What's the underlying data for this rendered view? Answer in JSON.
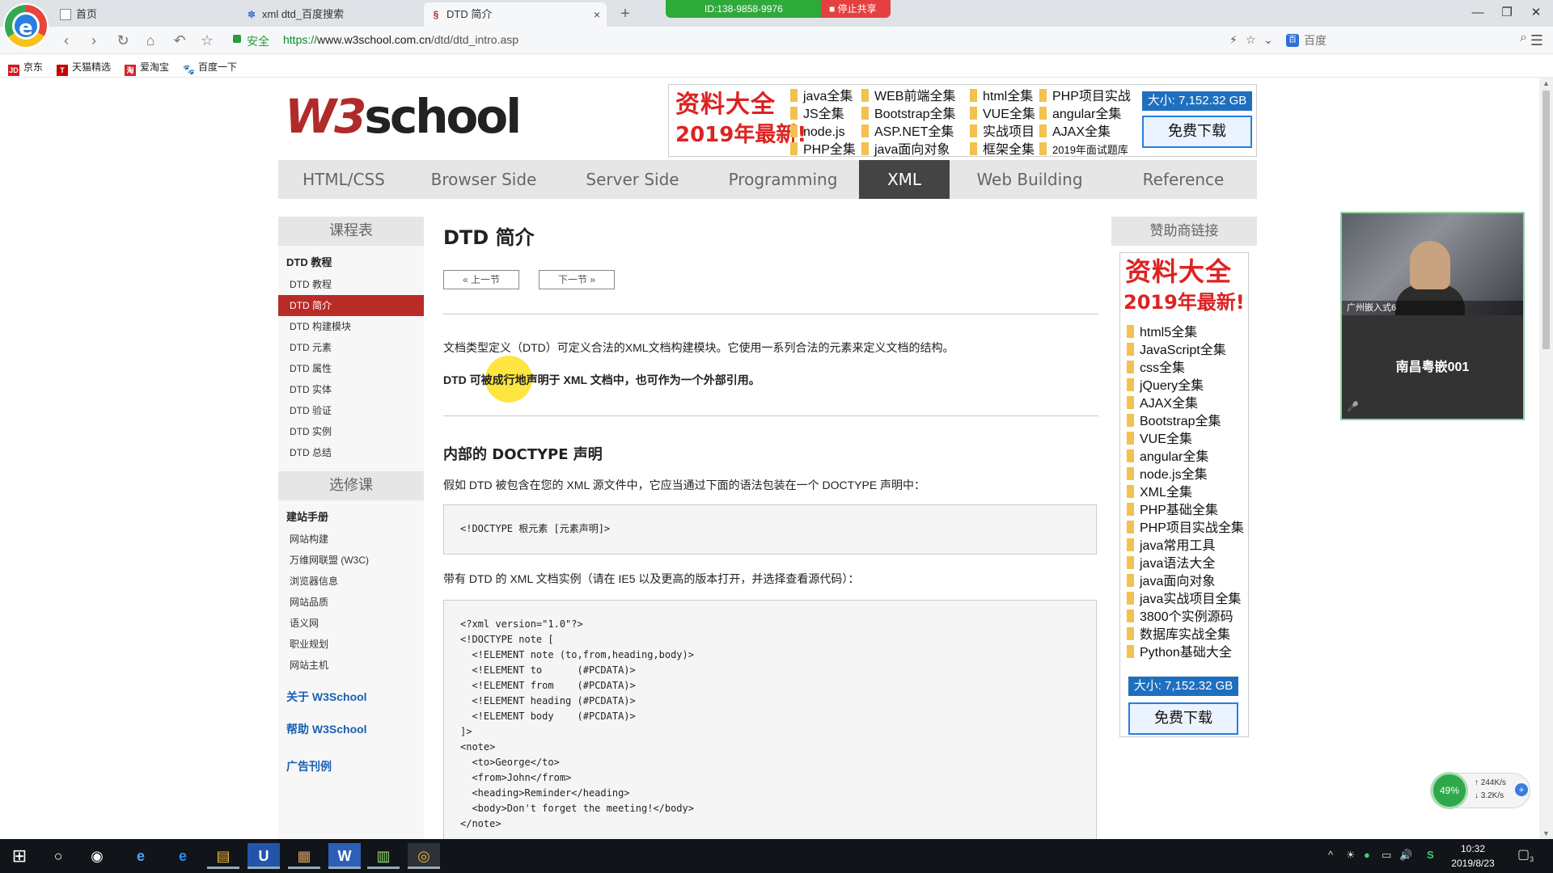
{
  "browser": {
    "tabs": [
      {
        "label": "首页",
        "icon": "document-icon"
      },
      {
        "label": "xml dtd_百度搜索",
        "icon": "baidu-paw-icon"
      },
      {
        "label": "DTD 简介",
        "icon": "w3school-favicon-icon"
      }
    ],
    "new_tab": "+",
    "close_tab": "×",
    "share": {
      "id_label": "ID:138-9858-9976",
      "stop_label": "停止共享"
    },
    "window_controls": {
      "minimize": "—",
      "restore": "❐",
      "close": "✕"
    },
    "nav": {
      "back": "‹",
      "forward": "›",
      "reload": "↻",
      "home": "⌂",
      "undo": "↶",
      "star": "☆"
    },
    "secure_label": "安全",
    "url_scheme": "https://",
    "url_domain": "www.w3school.com.cn",
    "url_path": "/dtd/dtd_intro.asp",
    "search_placeholder": "百度",
    "search_engine_glyph": "百",
    "search_go": "⌕",
    "menu": "☰",
    "right_tools": {
      "flash": "⚡",
      "star": "☆",
      "chevron": "⌄"
    },
    "bookmarks": [
      {
        "label": "京东",
        "badge": "JD",
        "color": "#d71920"
      },
      {
        "label": "天猫精选",
        "badge": "T",
        "color": "#c40000"
      },
      {
        "label": "爱淘宝",
        "badge": "淘",
        "color": "#d4232a"
      },
      {
        "label": "百度一下",
        "badge": "🐾",
        "color": "#2f6fd6"
      }
    ]
  },
  "site": {
    "logo_w3": "W3",
    "logo_school": "school",
    "ad_top": {
      "title": "资料大全",
      "subtitle": "2019年最新!",
      "columns": [
        [
          "java全集",
          "JS全集",
          "node.js",
          "PHP全集"
        ],
        [
          "WEB前端全集",
          "Bootstrap全集",
          "ASP.NET全集",
          "java面向对象"
        ],
        [
          "html全集",
          "VUE全集",
          "实战项目",
          "框架全集"
        ],
        [
          "PHP项目实战",
          "angular全集",
          "AJAX全集",
          "2019年面试题库"
        ]
      ],
      "size": "大小: 7,152.32 GB",
      "download": "免费下载"
    },
    "nav": [
      {
        "label": "HTML/CSS",
        "active": false
      },
      {
        "label": "Browser Side",
        "active": false
      },
      {
        "label": "Server Side",
        "active": false
      },
      {
        "label": "Programming",
        "active": false
      },
      {
        "label": "XML",
        "active": true
      },
      {
        "label": "Web Building",
        "active": false
      },
      {
        "label": "Reference",
        "active": false
      }
    ],
    "sidebar": {
      "course_title": "课程表",
      "group_title": "DTD 教程",
      "items": [
        "DTD 教程",
        "DTD 简介",
        "DTD 构建模块",
        "DTD 元素",
        "DTD 属性",
        "DTD 实体",
        "DTD 验证",
        "DTD 实例",
        "DTD 总结"
      ],
      "active_index": 1,
      "elective_title": "选修课",
      "site_group_title": "建站手册",
      "site_items": [
        "网站构建",
        "万维网联盟 (W3C)",
        "浏览器信息",
        "网站品质",
        "语义网",
        "职业规划",
        "网站主机"
      ],
      "links": [
        "关于 W3School",
        "帮助 W3School",
        "广告刊例"
      ]
    },
    "main": {
      "title": "DTD 简介",
      "prev": "« 上一节",
      "next": "下一节 »",
      "intro_p1": "文档类型定义（DTD）可定义合法的XML文档构建模块。它使用一系列合法的元素来定义文档的结构。",
      "intro_p2": "DTD 可被成行地声明于 XML 文档中，也可作为一个外部引用。",
      "section_title": "内部的 DOCTYPE 声明",
      "section_p": "假如 DTD 被包含在您的 XML 源文件中，它应当通过下面的语法包装在一个 DOCTYPE 声明中：",
      "syntax_code": "<!DOCTYPE 根元素 [元素声明]>",
      "example_p": "带有 DTD 的 XML 文档实例（请在 IE5 以及更高的版本打开，并选择查看源代码）：",
      "example_code": [
        "<?xml version=\"1.0\"?>",
        "<!DOCTYPE note [",
        "  <!ELEMENT note (to,from,heading,body)>",
        "  <!ELEMENT to      (#PCDATA)>",
        "  <!ELEMENT from    (#PCDATA)>",
        "  <!ELEMENT heading (#PCDATA)>",
        "  <!ELEMENT body    (#PCDATA)>",
        "]>",
        "<note>",
        "  <to>George</to>",
        "  <from>John</from>",
        "  <heading>Reminder</heading>",
        "  <body>Don't forget the meeting!</body>",
        "</note>"
      ]
    },
    "sponsor": {
      "head": "赞助商链接",
      "title": "资料大全",
      "subtitle": "2019年最新!",
      "items": [
        "html5全集",
        "JavaScript全集",
        "css全集",
        "jQuery全集",
        "AJAX全集",
        "Bootstrap全集",
        "VUE全集",
        "angular全集",
        "node.js全集",
        "XML全集",
        "PHP基础全集",
        "PHP项目实战全集",
        "java常用工具",
        "java语法大全",
        "java面向对象",
        "java实战项目全集",
        "3800个实例源码",
        "数据库实战全集",
        "Python基础大全"
      ],
      "size": "大小: 7,152.32 GB",
      "download": "免费下载"
    }
  },
  "scrollbar": {
    "up": "▲",
    "down": "▼"
  },
  "video": {
    "tag": "广州嵌入式6",
    "name": "南昌粤嵌001",
    "mic": "🎤"
  },
  "speed": {
    "percent": "49%",
    "up": "↑ 244K/s",
    "down": "↓ 3.2K/s",
    "plus": "+"
  },
  "taskbar": {
    "start": "⊞",
    "search": "○",
    "apps": [
      "◉",
      "e",
      "e",
      "▤",
      "U",
      "▦",
      "W",
      "▥",
      "◎"
    ],
    "time": "10:32",
    "date": "2019/8/23",
    "tray": [
      "^",
      "☀",
      "●",
      "▭",
      "🔊",
      "S"
    ],
    "notify": "▢",
    "notify_count": "3"
  }
}
